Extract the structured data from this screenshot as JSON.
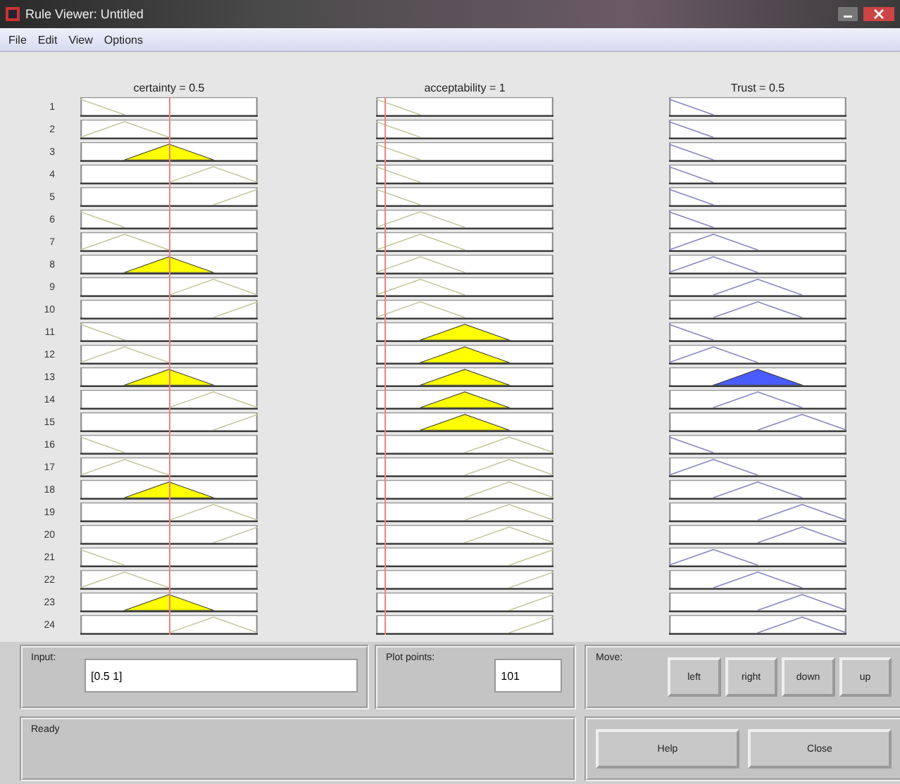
{
  "window": {
    "title": "Rule Viewer: Untitled"
  },
  "menu": [
    "File",
    "Edit",
    "View",
    "Options"
  ],
  "columns": [
    {
      "label": "certainty = 0.5",
      "kind": "input"
    },
    {
      "label": "acceptability = 1",
      "kind": "input"
    },
    {
      "label": "Trust = 0.5",
      "kind": "output"
    }
  ],
  "rules": [
    {
      "number": "1",
      "cells": [
        {
          "kind": "low",
          "fired": false
        },
        {
          "kind": "low",
          "fired": false
        },
        {
          "kind": "low",
          "fired": false
        }
      ]
    },
    {
      "number": "2",
      "cells": [
        {
          "kind": "lowmid",
          "fired": false
        },
        {
          "kind": "low",
          "fired": false
        },
        {
          "kind": "low",
          "fired": false
        }
      ]
    },
    {
      "number": "3",
      "cells": [
        {
          "kind": "mid",
          "fired": true
        },
        {
          "kind": "low",
          "fired": false
        },
        {
          "kind": "low",
          "fired": false
        }
      ]
    },
    {
      "number": "4",
      "cells": [
        {
          "kind": "midhigh",
          "fired": false
        },
        {
          "kind": "low",
          "fired": false
        },
        {
          "kind": "low",
          "fired": false
        }
      ]
    },
    {
      "number": "5",
      "cells": [
        {
          "kind": "high",
          "fired": false
        },
        {
          "kind": "low",
          "fired": false
        },
        {
          "kind": "low",
          "fired": false
        }
      ]
    },
    {
      "number": "6",
      "cells": [
        {
          "kind": "low",
          "fired": false
        },
        {
          "kind": "lowmid",
          "fired": false
        },
        {
          "kind": "low",
          "fired": false
        }
      ]
    },
    {
      "number": "7",
      "cells": [
        {
          "kind": "lowmid",
          "fired": false
        },
        {
          "kind": "lowmid",
          "fired": false
        },
        {
          "kind": "lowmid",
          "fired": false
        }
      ]
    },
    {
      "number": "8",
      "cells": [
        {
          "kind": "mid",
          "fired": true
        },
        {
          "kind": "lowmid",
          "fired": false
        },
        {
          "kind": "lowmid",
          "fired": false
        }
      ]
    },
    {
      "number": "9",
      "cells": [
        {
          "kind": "midhigh",
          "fired": false
        },
        {
          "kind": "lowmid",
          "fired": false
        },
        {
          "kind": "mid",
          "fired": false
        }
      ]
    },
    {
      "number": "10",
      "cells": [
        {
          "kind": "high",
          "fired": false
        },
        {
          "kind": "lowmid",
          "fired": false
        },
        {
          "kind": "mid",
          "fired": false
        }
      ]
    },
    {
      "number": "11",
      "cells": [
        {
          "kind": "low",
          "fired": false
        },
        {
          "kind": "mid",
          "fired": true
        },
        {
          "kind": "low",
          "fired": false
        }
      ]
    },
    {
      "number": "12",
      "cells": [
        {
          "kind": "lowmid",
          "fired": false
        },
        {
          "kind": "mid",
          "fired": true
        },
        {
          "kind": "lowmid",
          "fired": false
        }
      ]
    },
    {
      "number": "13",
      "cells": [
        {
          "kind": "mid",
          "fired": true
        },
        {
          "kind": "mid",
          "fired": true
        },
        {
          "kind": "mid",
          "fired": true
        }
      ]
    },
    {
      "number": "14",
      "cells": [
        {
          "kind": "midhigh",
          "fired": false
        },
        {
          "kind": "mid",
          "fired": true
        },
        {
          "kind": "mid",
          "fired": false
        }
      ]
    },
    {
      "number": "15",
      "cells": [
        {
          "kind": "high",
          "fired": false
        },
        {
          "kind": "mid",
          "fired": true
        },
        {
          "kind": "midhigh",
          "fired": false
        }
      ]
    },
    {
      "number": "16",
      "cells": [
        {
          "kind": "low",
          "fired": false
        },
        {
          "kind": "midhigh",
          "fired": false
        },
        {
          "kind": "low",
          "fired": false
        }
      ]
    },
    {
      "number": "17",
      "cells": [
        {
          "kind": "lowmid",
          "fired": false
        },
        {
          "kind": "midhigh",
          "fired": false
        },
        {
          "kind": "lowmid",
          "fired": false
        }
      ]
    },
    {
      "number": "18",
      "cells": [
        {
          "kind": "mid",
          "fired": true
        },
        {
          "kind": "midhigh",
          "fired": false
        },
        {
          "kind": "mid",
          "fired": false
        }
      ]
    },
    {
      "number": "19",
      "cells": [
        {
          "kind": "midhigh",
          "fired": false
        },
        {
          "kind": "midhigh",
          "fired": false
        },
        {
          "kind": "midhigh",
          "fired": false
        }
      ]
    },
    {
      "number": "20",
      "cells": [
        {
          "kind": "high",
          "fired": false
        },
        {
          "kind": "midhigh",
          "fired": false
        },
        {
          "kind": "midhigh",
          "fired": false
        }
      ]
    },
    {
      "number": "21",
      "cells": [
        {
          "kind": "low",
          "fired": false
        },
        {
          "kind": "high",
          "fired": false
        },
        {
          "kind": "lowmid",
          "fired": false
        }
      ]
    },
    {
      "number": "22",
      "cells": [
        {
          "kind": "lowmid",
          "fired": false
        },
        {
          "kind": "high",
          "fired": false
        },
        {
          "kind": "mid",
          "fired": false
        }
      ]
    },
    {
      "number": "23",
      "cells": [
        {
          "kind": "mid",
          "fired": true
        },
        {
          "kind": "high",
          "fired": false
        },
        {
          "kind": "midhigh",
          "fired": false
        }
      ]
    },
    {
      "number": "24",
      "cells": [
        {
          "kind": "midhigh",
          "fired": false
        },
        {
          "kind": "high",
          "fired": false
        },
        {
          "kind": "midhigh",
          "fired": false
        }
      ]
    }
  ],
  "input": {
    "label": "Input:",
    "value": "[0.5 1]"
  },
  "plot_points": {
    "label": "Plot points:",
    "value": "101"
  },
  "move": {
    "label": "Move:",
    "buttons": [
      "left",
      "right",
      "down",
      "up"
    ]
  },
  "status": "Ready",
  "buttons": [
    "Help",
    "Close"
  ]
}
